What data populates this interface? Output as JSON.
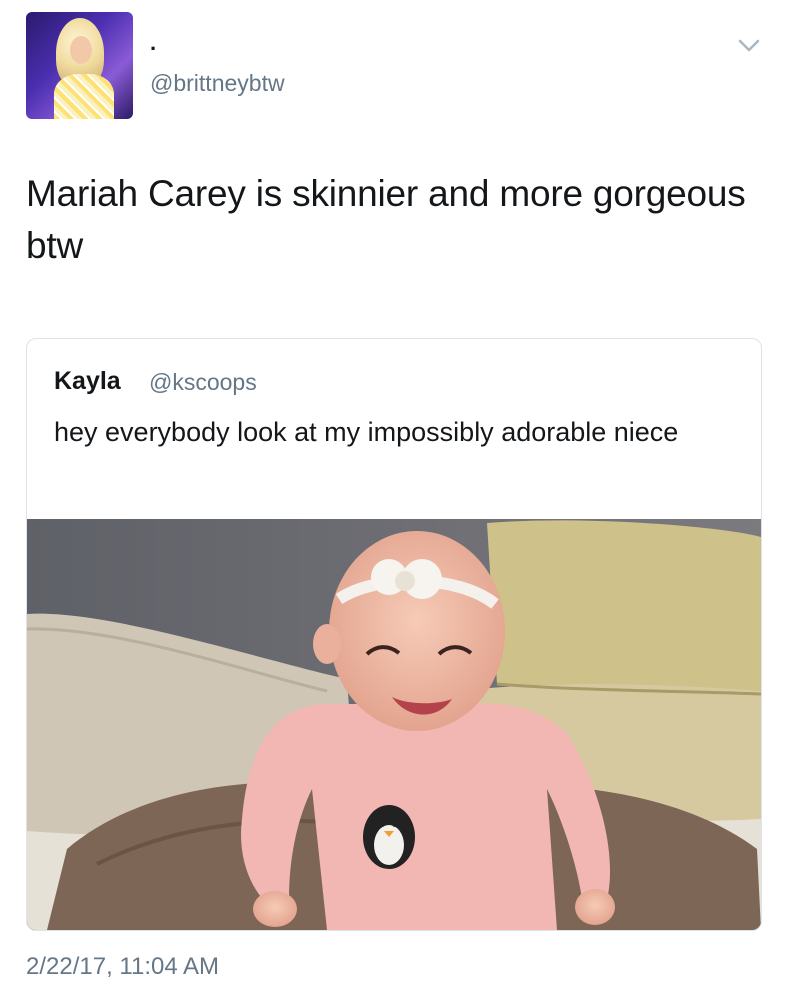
{
  "author": {
    "display_name": ".",
    "handle": "@brittneybtw"
  },
  "tweet": {
    "text": "Mariah Carey is skinnier and more gorgeous btw",
    "timestamp": "2/22/17, 11:04 AM"
  },
  "quoted_tweet": {
    "name": "Kayla",
    "handle": "@kscoops",
    "text": "hey everybody look at my impossibly adorable niece"
  },
  "icons": {
    "menu": "chevron-down-icon"
  },
  "colors": {
    "text": "#14171a",
    "secondary": "#657786",
    "border": "#dde3e8"
  }
}
